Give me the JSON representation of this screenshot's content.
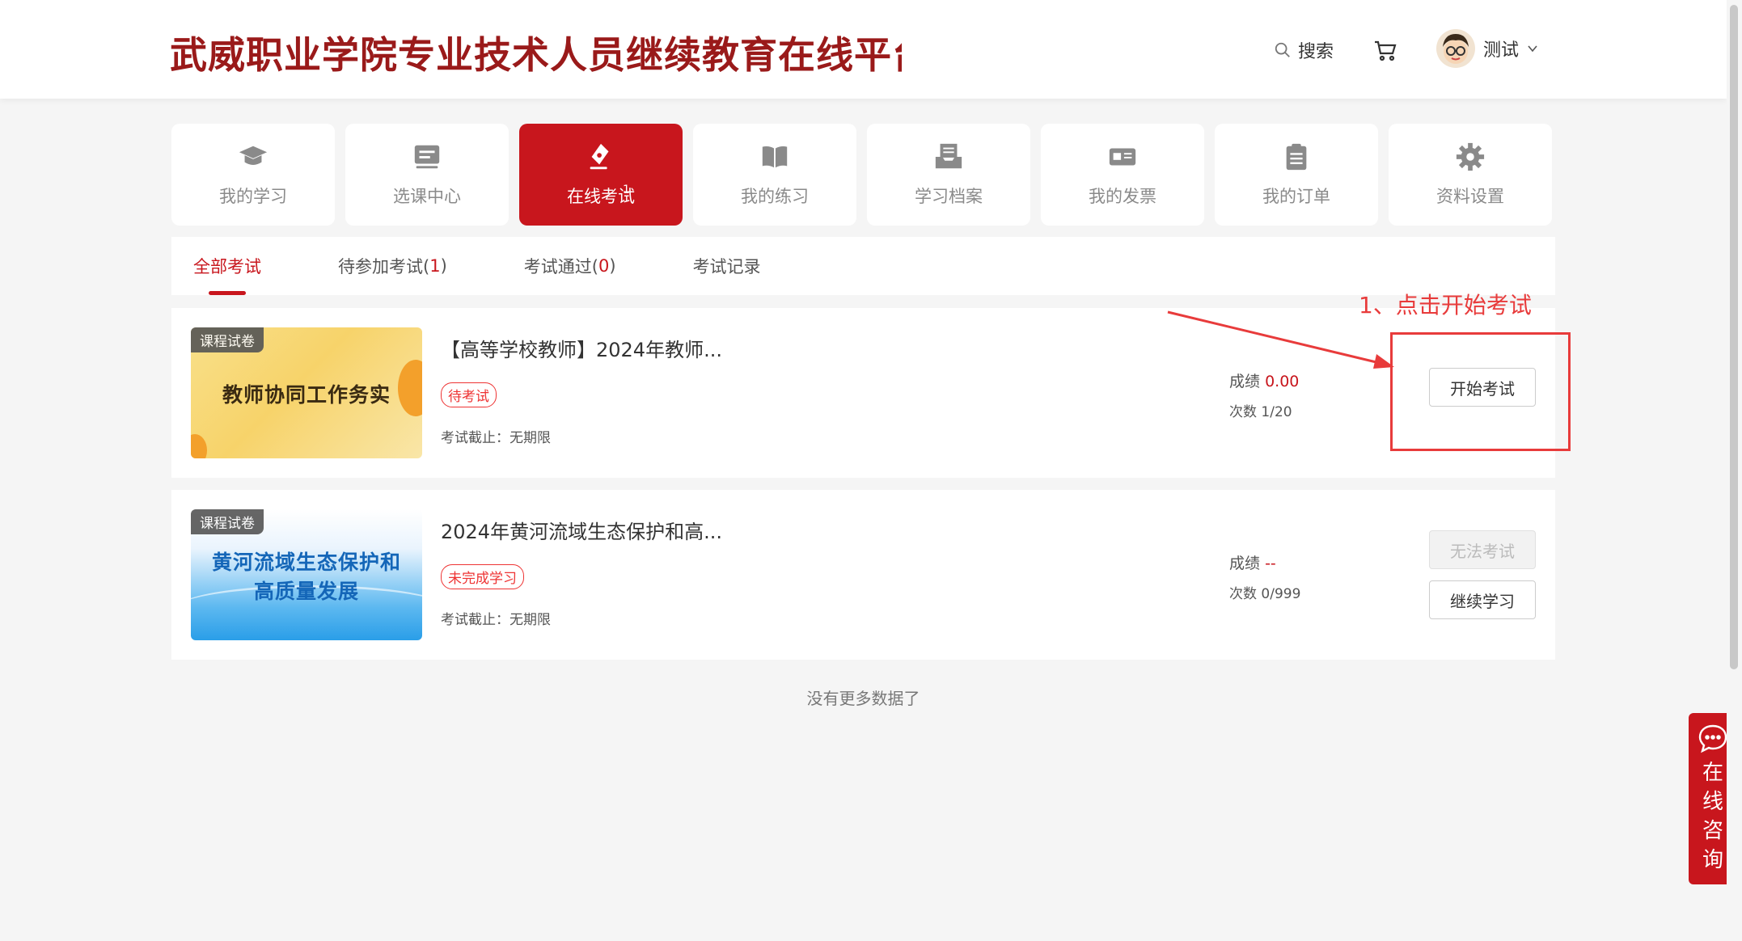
{
  "header": {
    "site_title": "武威职业学院专业技术人员继续教育在线平台",
    "search_label": "搜索",
    "username": "测试"
  },
  "nav": [
    {
      "label": "我的学习",
      "icon": "graduation-cap-icon"
    },
    {
      "label": "选课中心",
      "icon": "monitor-icon"
    },
    {
      "label": "在线考试",
      "icon": "pen-icon",
      "badge": "1",
      "active": true
    },
    {
      "label": "我的练习",
      "icon": "book-icon"
    },
    {
      "label": "学习档案",
      "icon": "inbox-icon"
    },
    {
      "label": "我的发票",
      "icon": "invoice-icon"
    },
    {
      "label": "我的订单",
      "icon": "clipboard-icon"
    },
    {
      "label": "资料设置",
      "icon": "gear-icon"
    }
  ],
  "tabs": {
    "all": "全部考试",
    "pending_label": "待参加考试(",
    "pending_count": "1",
    "passed_label": "考试通过(",
    "passed_count": "0",
    "close": ")",
    "records": "考试记录"
  },
  "exams": [
    {
      "thumb_tag": "课程试卷",
      "thumb_text": "教师协同工作务实",
      "title": "【高等学校教师】2024年教师...",
      "status": "待考试",
      "deadline": "考试截止：无期限",
      "score_label": "成绩",
      "score": "0.00",
      "attempts": "次数 1/20",
      "primary_button": "开始考试"
    },
    {
      "thumb_tag": "课程试卷",
      "thumb_text_line1": "黄河流域生态保护和",
      "thumb_text_line2": "高质量发展",
      "title": "2024年黄河流域生态保护和高...",
      "status": "未完成学习",
      "deadline": "考试截止：无期限",
      "score_label": "成绩",
      "score": "--",
      "attempts": "次数 0/999",
      "disabled_button": "无法考试",
      "secondary_button": "继续学习"
    }
  ],
  "footer_text": "没有更多数据了",
  "annotation": {
    "text": "1、点击开始考试",
    "color": "#e83b3b"
  },
  "consult": {
    "label": "在线咨询"
  },
  "colors": {
    "brand": "#c8161d",
    "title": "#9a1a1a"
  }
}
